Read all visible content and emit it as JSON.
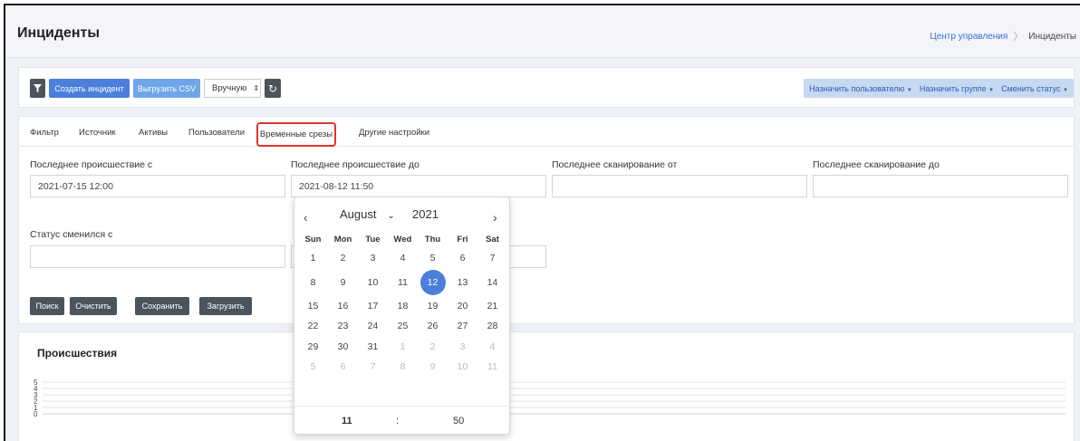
{
  "header": {
    "title": "Инциденты",
    "breadcrumb": {
      "parent": "Центр управления",
      "current": "Инциденты"
    }
  },
  "toolbar": {
    "filter_icon": "filter-icon",
    "create_label": "Создать инцидент",
    "export_label": "Выгрузить CSV",
    "mode_value": "Вручную",
    "refresh_icon": "refresh-icon",
    "assign_user_label": "Назначить пользователю",
    "assign_group_label": "Назначить группе",
    "change_status_label": "Сменить статус"
  },
  "tabs": {
    "filter": "Фильтр",
    "source": "Источник",
    "assets": "Активы",
    "users": "Пользователи",
    "time_slices": "Временные срезы",
    "other": "Другие настройки"
  },
  "fields": {
    "last_incident_from": {
      "label": "Последнее происшествие с",
      "value": "2021-07-15 12:00"
    },
    "last_incident_to": {
      "label": "Последнее происшествие до",
      "value": "2021-08-12 11:50"
    },
    "last_scan_from": {
      "label": "Последнее сканирование от",
      "value": ""
    },
    "last_scan_to": {
      "label": "Последнее сканирование до",
      "value": ""
    },
    "status_changed_from": {
      "label": "Статус сменился с",
      "value": ""
    }
  },
  "actions": {
    "search": "Поиск",
    "clear": "Очистить",
    "save": "Сохранить",
    "load": "Загрузить"
  },
  "chart": {
    "title": "Происшествия",
    "y_ticks": [
      "5",
      "4",
      "3",
      "2",
      "1",
      "0"
    ]
  },
  "datepicker": {
    "month": "August",
    "year": "2021",
    "prev_icon": "chevron-left-icon",
    "next_icon": "chevron-right-icon",
    "weekdays": [
      "Sun",
      "Mon",
      "Tue",
      "Wed",
      "Thu",
      "Fri",
      "Sat"
    ],
    "weeks": [
      [
        "1",
        "2",
        "3",
        "4",
        "5",
        "6",
        "7"
      ],
      [
        "8",
        "9",
        "10",
        "11",
        "12",
        "13",
        "14"
      ],
      [
        "15",
        "16",
        "17",
        "18",
        "19",
        "20",
        "21"
      ],
      [
        "22",
        "23",
        "24",
        "25",
        "26",
        "27",
        "28"
      ],
      [
        "29",
        "30",
        "31",
        "1",
        "2",
        "3",
        "4"
      ],
      [
        "5",
        "6",
        "7",
        "8",
        "9",
        "10",
        "11"
      ]
    ],
    "selected_day": "12",
    "hour": "11",
    "separator": ":",
    "minute": "50"
  }
}
